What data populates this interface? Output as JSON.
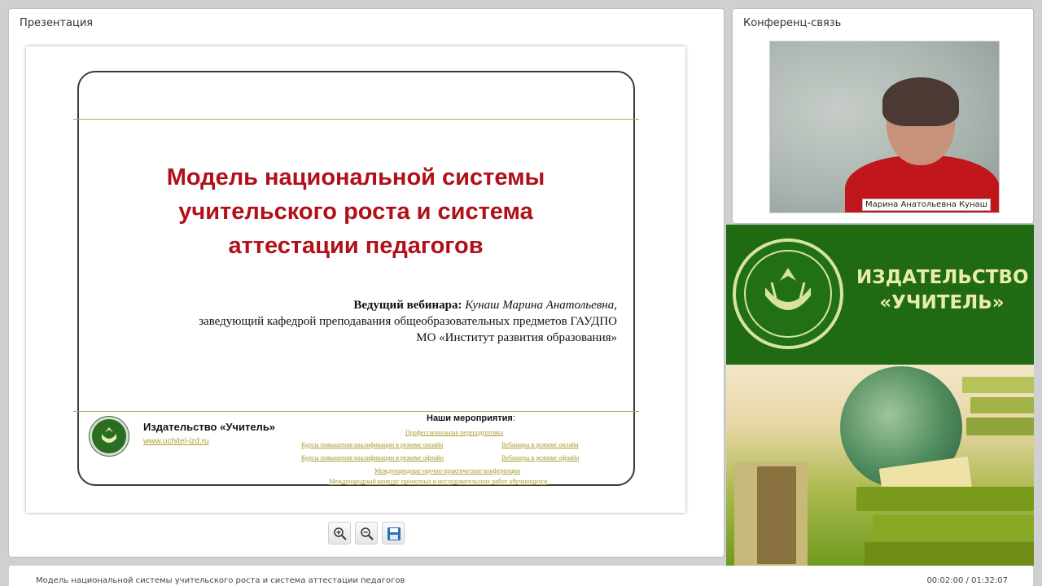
{
  "presentation": {
    "panel_title": "Презентация",
    "slide": {
      "title_lines": [
        "Модель национальной системы",
        "учительского роста и система",
        "аттестации педагогов"
      ],
      "presenter_label": "Ведущий вебинара:",
      "presenter_name": "Кунаш Марина Анатольевна,",
      "presenter_line2": "заведующий кафедрой преподавания общеобразовательных предметов ГАУДПО",
      "presenter_line3": "МО «Институт развития образования»",
      "publisher": "Издательство «Учитель»",
      "publisher_url": "www.uchitel-izd.ru",
      "events_title": "Наши мероприятия",
      "events_title_suffix": ":",
      "events": [
        "Профессиональная переподготовка",
        "Курсы повышения квалификации в режиме онлайн",
        "Вебинары в режиме онлайн",
        "Курсы повышения квалификации в режиме офлайн",
        "Вебинары в режиме офлайн",
        "Международные научно-практические конференции",
        "Международный конкурс проектных и исследовательских работ обучающихся"
      ]
    },
    "toolbar": {
      "zoom_in_icon": "zoom-in-icon",
      "zoom_out_icon": "zoom-out-icon",
      "save_icon": "save-icon"
    }
  },
  "conference": {
    "panel_title": "Конференц-связь",
    "participant_name": "Марина Анатольевна Кунаш"
  },
  "banner": {
    "line1": "ИЗДАТЕЛЬСТВО",
    "line2": "«УЧИТЕЛЬ»"
  },
  "bottom": {
    "title": "Модель национальной системы учительского роста и система аттестации педагогов",
    "time": "00:02:00 / 01:32:07"
  },
  "colors": {
    "title_red": "#b01018",
    "publisher_green": "#1f6a12",
    "link_gold": "#a8982c"
  }
}
